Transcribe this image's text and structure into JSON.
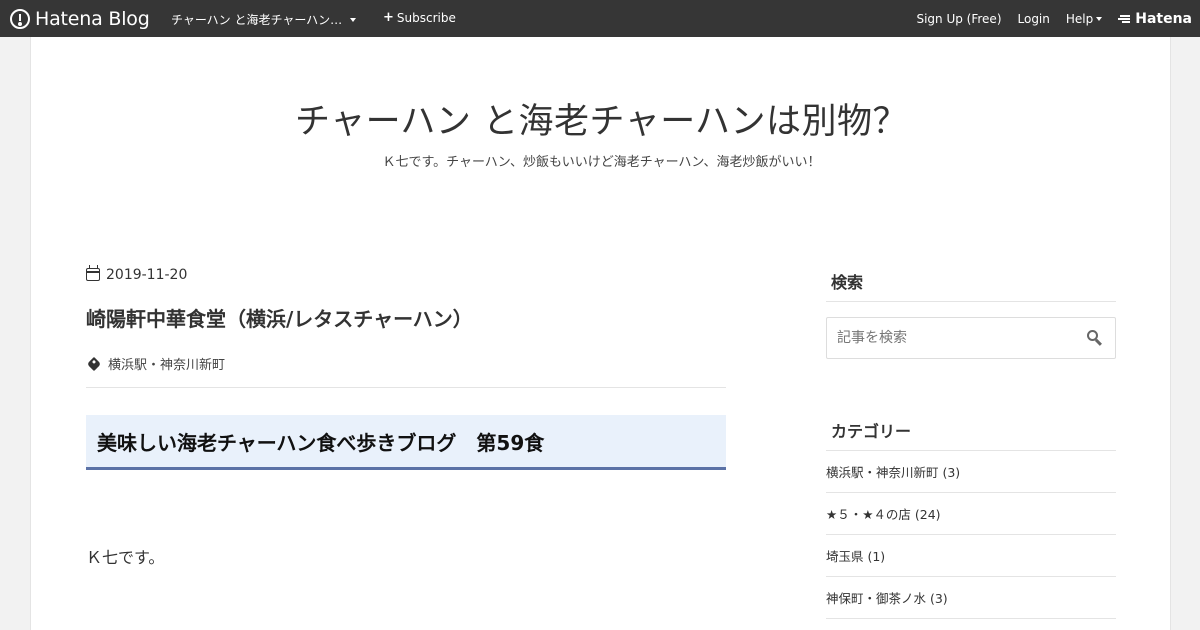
{
  "globalbar": {
    "logo_text": "Hatena Blog",
    "blog_name": "チャーハン と海老チャーハン…",
    "subscribe_label": "Subscribe",
    "signup_label": "Sign Up (Free)",
    "login_label": "Login",
    "help_label": "Help",
    "hatena_label": "Hatena"
  },
  "header": {
    "title": "チャーハン と海老チャーハンは別物？",
    "description": "Ｋ七です。チャーハン、炒飯もいいけど海老チャーハン、海老炒飯がいい！"
  },
  "entry": {
    "date": "2019-11-20",
    "title": "崎陽軒中華食堂（横浜/レタスチャーハン）",
    "category": "横浜駅・神奈川新町",
    "h3": "美味しい海老チャーハン食べ歩きブログ　第59食",
    "paragraph": "Ｋ七です。"
  },
  "sidebar": {
    "search_heading": "検索",
    "search_placeholder": "記事を検索",
    "category_heading": "カテゴリー",
    "categories": [
      "横浜駅・神奈川新町 (3)",
      "★５・★４の店 (24)",
      "埼玉県 (1)",
      "神保町・御茶ノ水 (3)"
    ]
  }
}
